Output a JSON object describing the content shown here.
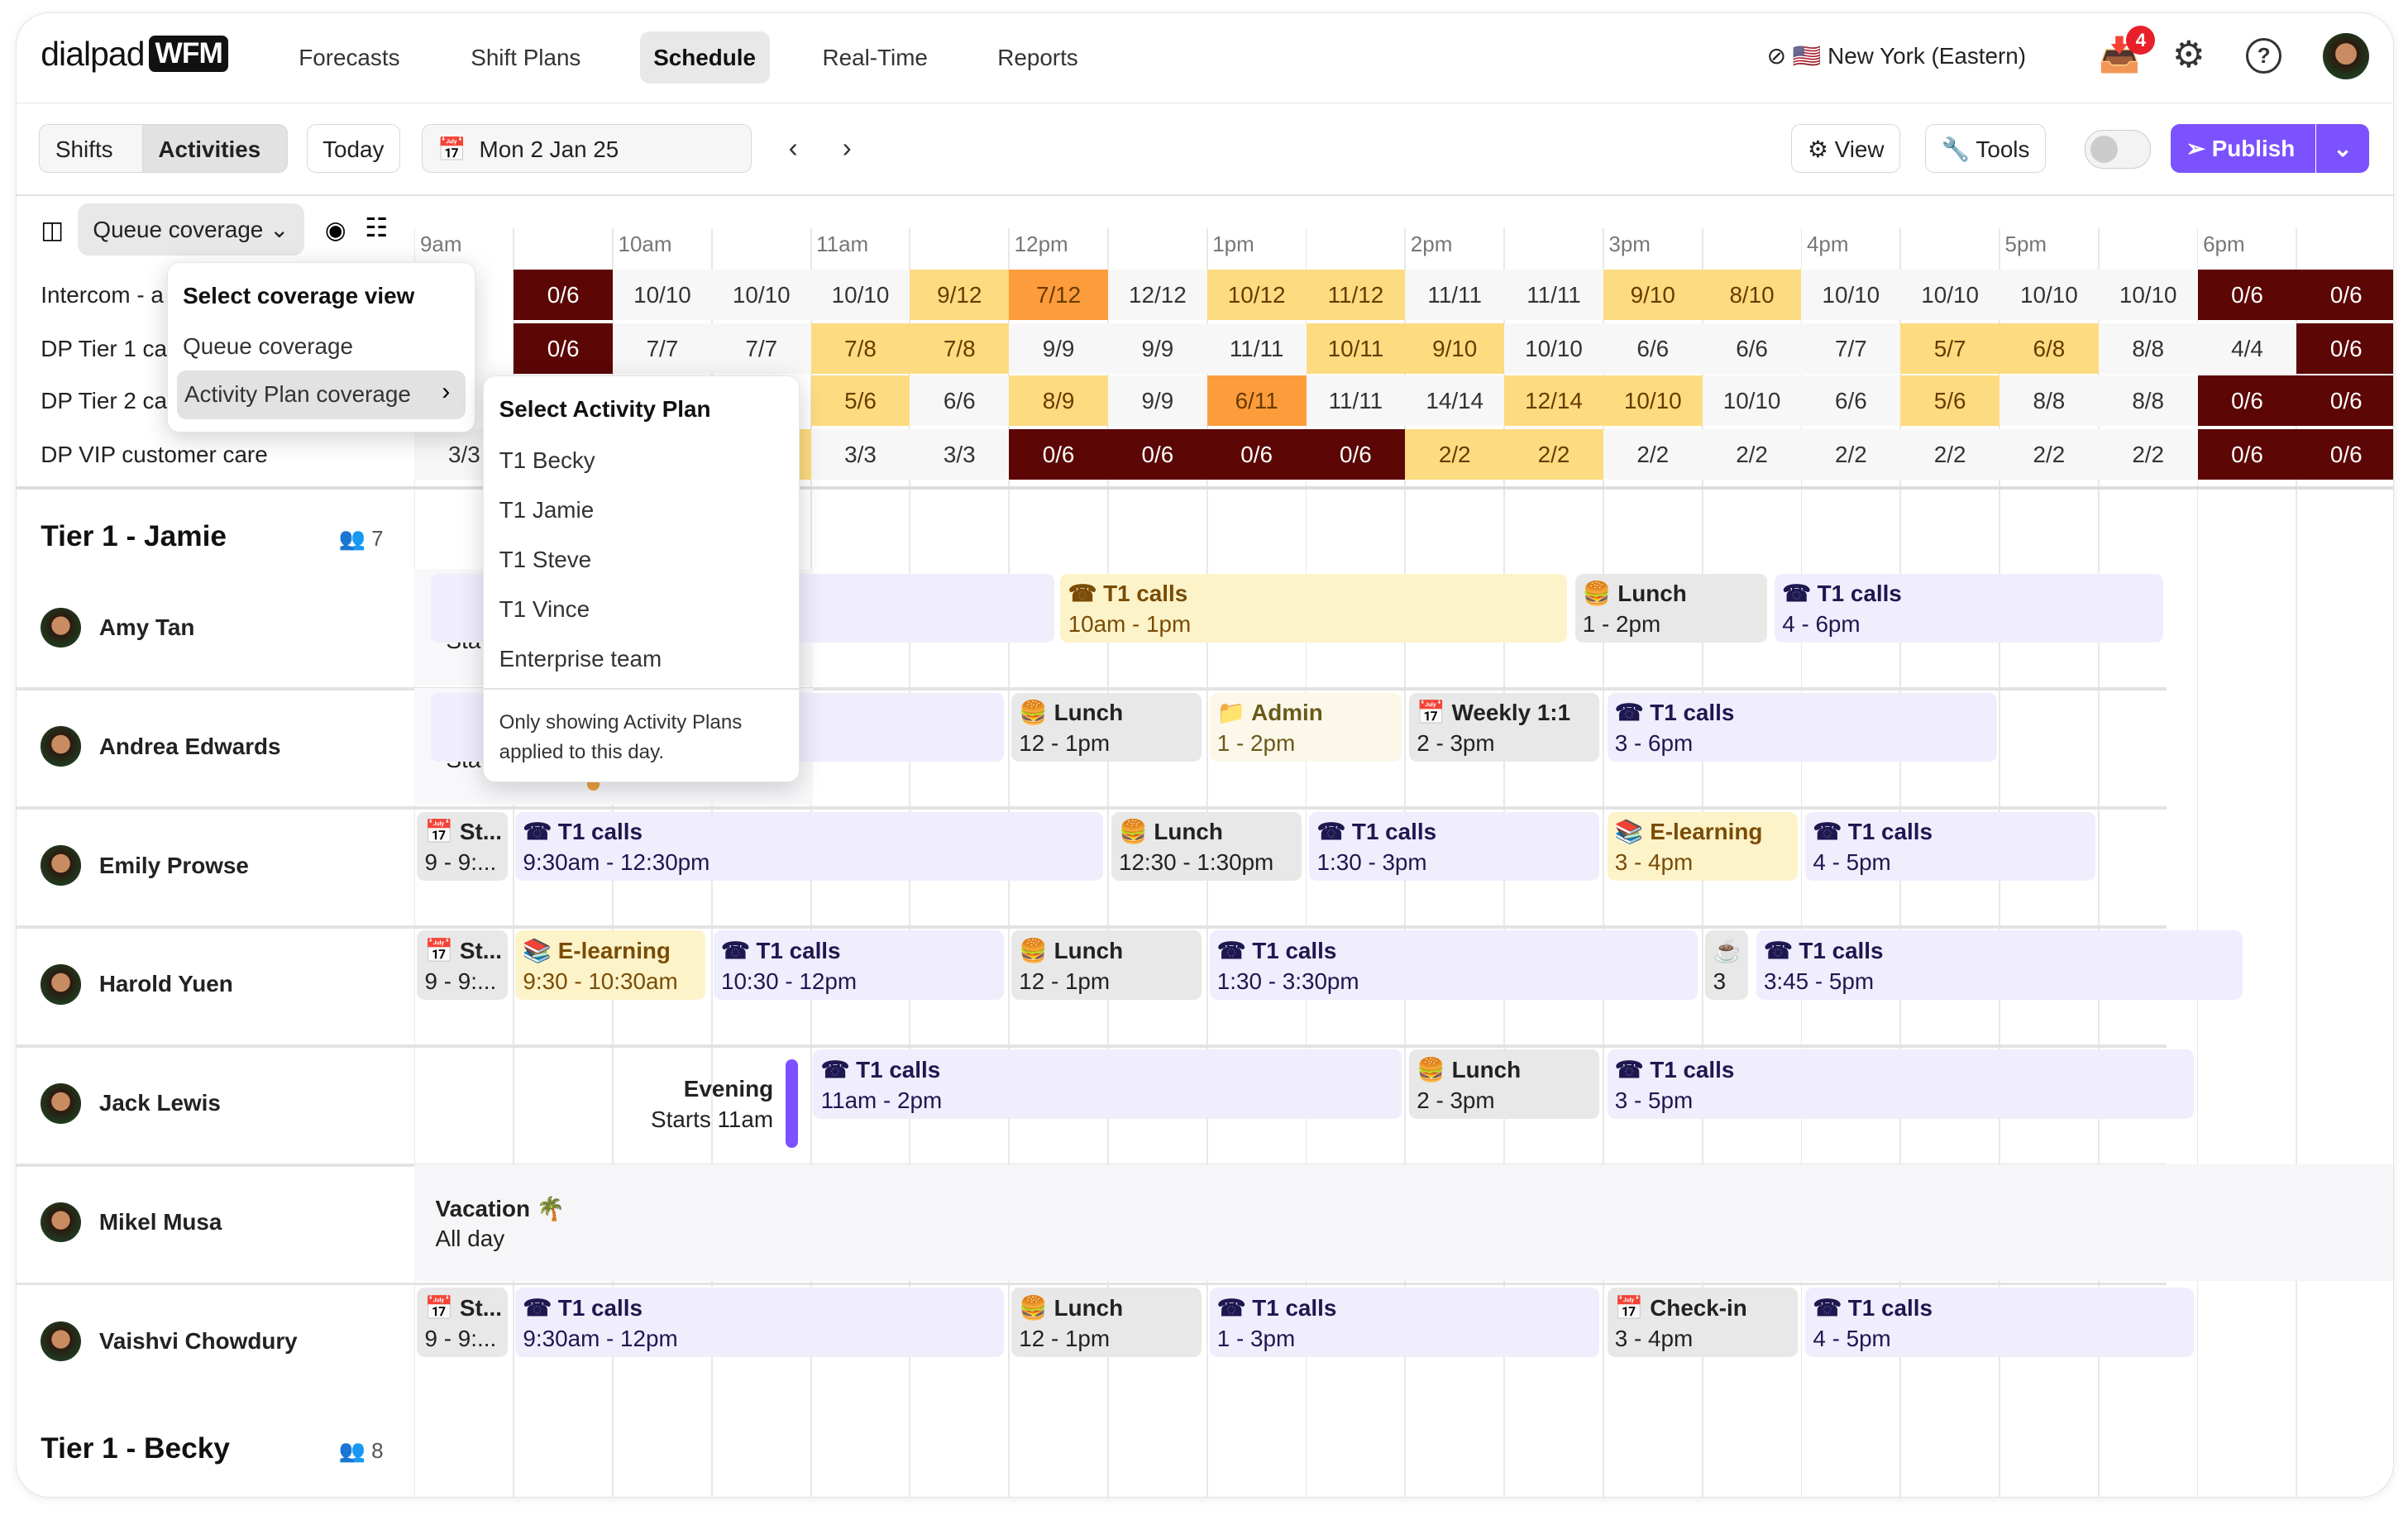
{
  "app": {
    "brand": "dialpad",
    "product": "WFM"
  },
  "nav": [
    "Forecasts",
    "Shift Plans",
    "Schedule",
    "Real-Time",
    "Reports"
  ],
  "nav_active": "Schedule",
  "header": {
    "timezone": "🇺🇸 New York (Eastern)",
    "notifications": "4"
  },
  "toolbar": {
    "shifts": "Shifts",
    "activities": "Activities",
    "today": "Today",
    "date": "Mon 2 Jan 25",
    "view": "View",
    "tools": "Tools",
    "publish": "Publish",
    "toggle_on": false
  },
  "coverage": {
    "selector": "Queue coverage",
    "times": [
      "9am",
      "10am",
      "11am",
      "12pm",
      "1pm",
      "2pm",
      "3pm",
      "4pm",
      "5pm",
      "6pm"
    ],
    "colors": {
      "dark": "#5c0606",
      "orange": "#fd9c3c",
      "yellow": "#fddb80",
      "light": "#f7f7f7"
    },
    "rows": [
      {
        "label": "Intercom - a",
        "cells": [
          [
            "",
            ""
          ],
          [
            "0/6",
            "dark"
          ],
          [
            "10/10",
            "light"
          ],
          [
            "10/10",
            "light"
          ],
          [
            "10/10",
            "light"
          ],
          [
            "9/12",
            "yellow"
          ],
          [
            "7/12",
            "orange"
          ],
          [
            "12/12",
            "light"
          ],
          [
            "10/12",
            "yellow"
          ],
          [
            "11/12",
            "yellow"
          ],
          [
            "11/11",
            "light"
          ],
          [
            "11/11",
            "light"
          ],
          [
            "9/10",
            "yellow"
          ],
          [
            "8/10",
            "yellow"
          ],
          [
            "10/10",
            "light"
          ],
          [
            "10/10",
            "light"
          ],
          [
            "10/10",
            "light"
          ],
          [
            "10/10",
            "light"
          ],
          [
            "0/6",
            "dark"
          ],
          [
            "0/6",
            "dark"
          ]
        ]
      },
      {
        "label": "DP Tier 1 ca",
        "cells": [
          [
            "",
            ""
          ],
          [
            "0/6",
            "dark"
          ],
          [
            "7/7",
            "light"
          ],
          [
            "7/7",
            "light"
          ],
          [
            "7/8",
            "yellow"
          ],
          [
            "7/8",
            "yellow"
          ],
          [
            "9/9",
            "light"
          ],
          [
            "9/9",
            "light"
          ],
          [
            "11/11",
            "light"
          ],
          [
            "10/11",
            "yellow"
          ],
          [
            "9/10",
            "yellow"
          ],
          [
            "10/10",
            "light"
          ],
          [
            "6/6",
            "light"
          ],
          [
            "6/6",
            "light"
          ],
          [
            "7/7",
            "light"
          ],
          [
            "5/7",
            "yellow"
          ],
          [
            "6/8",
            "yellow"
          ],
          [
            "8/8",
            "light"
          ],
          [
            "4/4",
            "light"
          ],
          [
            "0/6",
            "dark"
          ]
        ]
      },
      {
        "label": "DP Tier 2 ca",
        "cells": [
          [
            "",
            ""
          ],
          [
            "",
            ""
          ],
          [
            "",
            ""
          ],
          [
            "",
            ""
          ],
          [
            "5/6",
            "yellow"
          ],
          [
            "6/6",
            "light"
          ],
          [
            "8/9",
            "yellow"
          ],
          [
            "9/9",
            "light"
          ],
          [
            "6/11",
            "orange"
          ],
          [
            "11/11",
            "light"
          ],
          [
            "14/14",
            "light"
          ],
          [
            "12/14",
            "yellow"
          ],
          [
            "10/10",
            "yellow"
          ],
          [
            "10/10",
            "light"
          ],
          [
            "6/6",
            "light"
          ],
          [
            "5/6",
            "yellow"
          ],
          [
            "8/8",
            "light"
          ],
          [
            "8/8",
            "light"
          ],
          [
            "0/6",
            "dark"
          ],
          [
            "0/6",
            "dark"
          ]
        ]
      },
      {
        "label": "DP VIP customer care",
        "cells": [
          [
            "3/3",
            "light"
          ],
          [
            "",
            ""
          ],
          [
            "",
            ""
          ],
          [
            "",
            "yellow"
          ],
          [
            "3/3",
            "light"
          ],
          [
            "3/3",
            "light"
          ],
          [
            "0/6",
            "dark"
          ],
          [
            "0/6",
            "dark"
          ],
          [
            "0/6",
            "dark"
          ],
          [
            "0/6",
            "dark"
          ],
          [
            "2/2",
            "yellow"
          ],
          [
            "2/2",
            "yellow"
          ],
          [
            "2/2",
            "light"
          ],
          [
            "2/2",
            "light"
          ],
          [
            "2/2",
            "light"
          ],
          [
            "2/2",
            "light"
          ],
          [
            "2/2",
            "light"
          ],
          [
            "2/2",
            "light"
          ],
          [
            "0/6",
            "dark"
          ],
          [
            "0/6",
            "dark"
          ]
        ]
      }
    ]
  },
  "coverage_menu": {
    "title": "Select coverage view",
    "items": [
      "Queue coverage",
      "Activity Plan coverage"
    ]
  },
  "plan_menu": {
    "title": "Select Activity Plan",
    "items": [
      "T1 Becky",
      "T1 Jamie",
      "T1 Steve",
      "T1 Vince",
      "Enterprise team"
    ],
    "note": "Only showing Activity Plans applied to this day."
  },
  "groups": [
    {
      "name": "Tier 1 - Jamie",
      "count": "7"
    },
    {
      "name": "Tier 1 - Becky",
      "count": "8"
    }
  ],
  "people": [
    {
      "name": "Amy Tan",
      "blocks": [
        [
          "purple",
          "",
          ""
        ],
        [
          "yellow",
          "☎ T1 calls",
          "10am - 1pm"
        ],
        [
          "grey",
          "🍔 Lunch",
          "1 - 2pm"
        ],
        [
          "purple",
          "☎ T1 calls",
          "4 - 6pm"
        ]
      ],
      "note": "Sta"
    },
    {
      "name": "Andrea Edwards",
      "blocks": [
        [
          "purple",
          "",
          ""
        ],
        [
          "grey",
          "🍔 Lunch",
          "12 - 1pm"
        ],
        [
          "cream",
          "📁 Admin",
          "1 - 2pm"
        ],
        [
          "grey",
          "📅 Weekly 1:1",
          "2 - 3pm"
        ],
        [
          "purple",
          "☎ T1 calls",
          "3 - 6pm"
        ]
      ],
      "note": "Sta"
    },
    {
      "name": "Emily Prowse",
      "blocks": [
        [
          "grey",
          "📅 St...",
          "9 - 9:..."
        ],
        [
          "purple",
          "☎ T1 calls",
          "9:30am - 12:30pm"
        ],
        [
          "grey",
          "🍔 Lunch",
          "12:30 - 1:30pm"
        ],
        [
          "purple",
          "☎ T1 calls",
          "1:30 - 3pm"
        ],
        [
          "yellow",
          "📚 E-learning",
          "3 - 4pm"
        ],
        [
          "purple",
          "☎ T1 calls",
          "4 - 5pm"
        ]
      ]
    },
    {
      "name": "Harold Yuen",
      "blocks": [
        [
          "grey",
          "📅 St...",
          "9 - 9:..."
        ],
        [
          "yellow",
          "📚 E-learning",
          "9:30 - 10:30am"
        ],
        [
          "purple",
          "☎ T1 calls",
          "10:30 - 12pm"
        ],
        [
          "grey",
          "🍔 Lunch",
          "12 - 1pm"
        ],
        [
          "purple",
          "☎ T1 calls",
          "1:30 - 3:30pm"
        ],
        [
          "grey",
          "☕",
          "3"
        ],
        [
          "purple",
          "☎ T1 calls",
          "3:45 - 5pm"
        ]
      ]
    },
    {
      "name": "Jack Lewis",
      "blocks": [
        [
          "purple",
          "☎ T1 calls",
          "11am - 2pm"
        ],
        [
          "grey",
          "🍔 Lunch",
          "2 - 3pm"
        ],
        [
          "purple",
          "☎ T1 calls",
          "3 - 5pm"
        ]
      ],
      "evening": "Evening",
      "evening_sub": "Starts 11am"
    },
    {
      "name": "Mikel Musa",
      "blocks": [],
      "vacation": "Vacation 🌴",
      "vacation_sub": "All day"
    },
    {
      "name": "Vaishvi Chowdury",
      "blocks": [
        [
          "grey",
          "📅 St...",
          "9 - 9:..."
        ],
        [
          "purple",
          "☎ T1 calls",
          "9:30am - 12pm"
        ],
        [
          "grey",
          "🍔 Lunch",
          "12 - 1pm"
        ],
        [
          "purple",
          "☎ T1 calls",
          "1 - 3pm"
        ],
        [
          "grey",
          "📅 Check-in",
          "3 - 4pm"
        ],
        [
          "purple",
          "☎ T1 calls",
          "4 - 5pm"
        ]
      ]
    }
  ]
}
